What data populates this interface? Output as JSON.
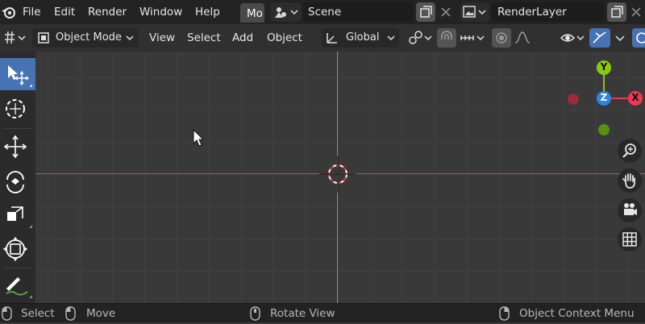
{
  "topbar": {
    "menus": [
      "File",
      "Edit",
      "Render",
      "Window",
      "Help"
    ],
    "workspace_tab": "Mo",
    "scene_label": "Scene",
    "view_layer_label": "RenderLayer"
  },
  "header": {
    "mode_label": "Object Mode",
    "menus": [
      "View",
      "Select",
      "Add",
      "Object"
    ],
    "orientation_label": "Global"
  },
  "toolbar": {
    "tools": [
      "select-box-icon",
      "cursor-icon",
      "move-icon",
      "rotate-icon",
      "scale-icon",
      "transform-icon",
      "annotate-icon"
    ],
    "active_index": 0
  },
  "gizmo": {
    "y_label": "Y",
    "z_label": "Z",
    "x_label": "X",
    "colors": {
      "x": "#f0374f",
      "y": "#8bc90a",
      "z": "#2f84e3"
    }
  },
  "status": {
    "select_label": "Select",
    "move_label": "Move",
    "rotate_label": "Rotate View",
    "context_label": "Object Context Menu"
  },
  "colors": {
    "accent": "#4772b3",
    "x_axis": "#b64b5a",
    "y_axis": "#7aa42c"
  }
}
